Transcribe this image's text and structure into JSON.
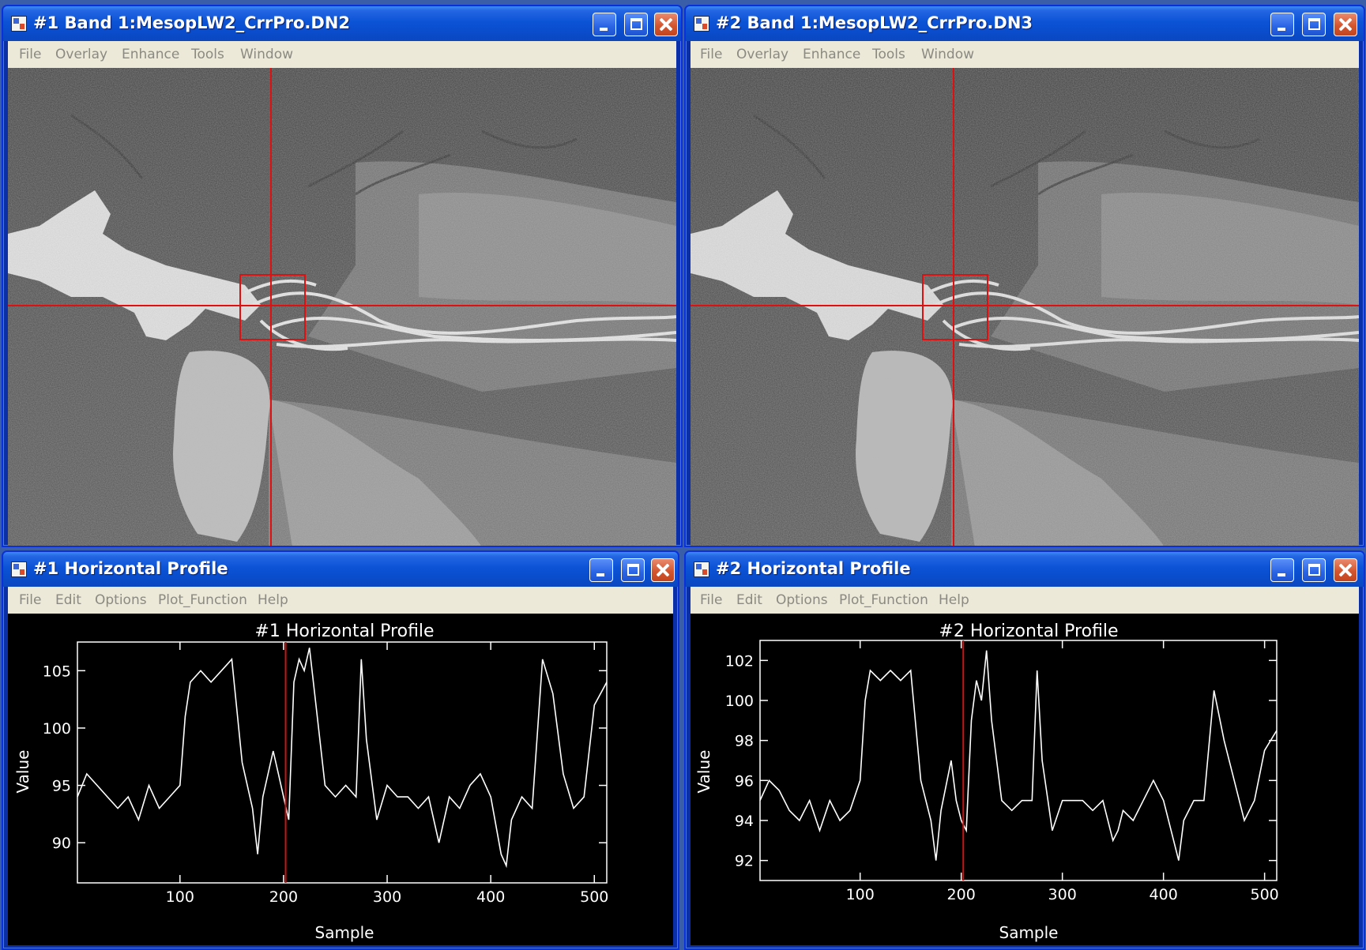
{
  "image_windows": [
    {
      "title": "#1 Band 1:MesopLW2_CrrPro.DN2",
      "menu": [
        "File",
        "Overlay",
        "Enhance",
        "Tools",
        "Window"
      ]
    },
    {
      "title": "#2 Band 1:MesopLW2_CrrPro.DN3",
      "menu": [
        "File",
        "Overlay",
        "Enhance",
        "Tools",
        "Window"
      ]
    }
  ],
  "profile_windows": [
    {
      "title": "#1 Horizontal Profile",
      "menu": [
        "File",
        "Edit",
        "Options",
        "Plot_Function",
        "Help"
      ]
    },
    {
      "title": "#2 Horizontal Profile",
      "menu": [
        "File",
        "Edit",
        "Options",
        "Plot_Function",
        "Help"
      ]
    }
  ],
  "icons": {
    "window_icon": "app-window-icon",
    "minimize": "minimize-icon",
    "maximize": "maximize-icon",
    "close": "close-icon"
  },
  "colors": {
    "crosshair": "#e01010",
    "cursor_line": "#c81414",
    "profile_line": "#ffffff",
    "plot_background": "#000000",
    "titlebar": "#0b53d6",
    "menubar": "#ece9d8"
  },
  "chart_data": [
    {
      "type": "line",
      "title": "#1 Horizontal Profile",
      "xlabel": "Sample",
      "ylabel": "Value",
      "xlim": [
        1,
        512
      ],
      "ylim": [
        86.5,
        107.5
      ],
      "xticks": [
        100,
        200,
        300,
        400,
        500
      ],
      "yticks": [
        90,
        95,
        100,
        105
      ],
      "cursor_x": 202,
      "grid": false,
      "series": [
        {
          "x": [
            1,
            10,
            20,
            30,
            40,
            50,
            60,
            70,
            80,
            90,
            100,
            105,
            110,
            120,
            130,
            140,
            150,
            160,
            170,
            175,
            180,
            190,
            195,
            200,
            205,
            210,
            215,
            220,
            225,
            230,
            240,
            250,
            260,
            270,
            275,
            280,
            290,
            300,
            310,
            320,
            330,
            340,
            350,
            355,
            360,
            370,
            380,
            390,
            400,
            410,
            415,
            420,
            430,
            440,
            450,
            460,
            470,
            480,
            490,
            500,
            512
          ],
          "values": [
            94,
            96,
            95,
            94,
            93,
            94,
            92,
            95,
            93,
            94,
            95,
            101,
            104,
            105,
            104,
            105,
            106,
            97,
            93,
            89,
            94,
            98,
            96,
            94,
            92,
            104,
            106,
            105,
            107,
            103,
            95,
            94,
            95,
            94,
            106,
            99,
            92,
            95,
            94,
            94,
            93,
            94,
            90,
            92,
            94,
            93,
            95,
            96,
            94,
            89,
            88,
            92,
            94,
            93,
            106,
            103,
            96,
            93,
            94,
            102,
            104
          ]
        }
      ]
    },
    {
      "type": "line",
      "title": "#2 Horizontal Profile",
      "xlabel": "Sample",
      "ylabel": "Value",
      "xlim": [
        1,
        512
      ],
      "ylim": [
        91,
        103
      ],
      "xticks": [
        100,
        200,
        300,
        400,
        500
      ],
      "yticks": [
        92,
        94,
        96,
        98,
        100,
        102
      ],
      "cursor_x": 202,
      "grid": false,
      "series": [
        {
          "x": [
            1,
            10,
            20,
            30,
            40,
            50,
            60,
            70,
            80,
            90,
            100,
            105,
            110,
            120,
            130,
            140,
            150,
            160,
            170,
            175,
            180,
            190,
            195,
            200,
            205,
            210,
            215,
            220,
            225,
            230,
            240,
            250,
            260,
            270,
            275,
            280,
            290,
            300,
            310,
            320,
            330,
            340,
            350,
            355,
            360,
            370,
            380,
            390,
            400,
            410,
            415,
            420,
            430,
            440,
            450,
            460,
            470,
            480,
            490,
            500,
            512
          ],
          "values": [
            95,
            96,
            95.5,
            94.5,
            94,
            95,
            93.5,
            95,
            94,
            94.5,
            96,
            100,
            101.5,
            101,
            101.5,
            101,
            101.5,
            96,
            94,
            92,
            94.5,
            97,
            95,
            94,
            93.5,
            99,
            101,
            100,
            102.5,
            99,
            95,
            94.5,
            95,
            95,
            101.5,
            97,
            93.5,
            95,
            95,
            95,
            94.5,
            95,
            93,
            93.5,
            94.5,
            94,
            95,
            96,
            95,
            93,
            92,
            94,
            95,
            95,
            100.5,
            98,
            96,
            94,
            95,
            97.5,
            98.5
          ]
        }
      ]
    }
  ]
}
